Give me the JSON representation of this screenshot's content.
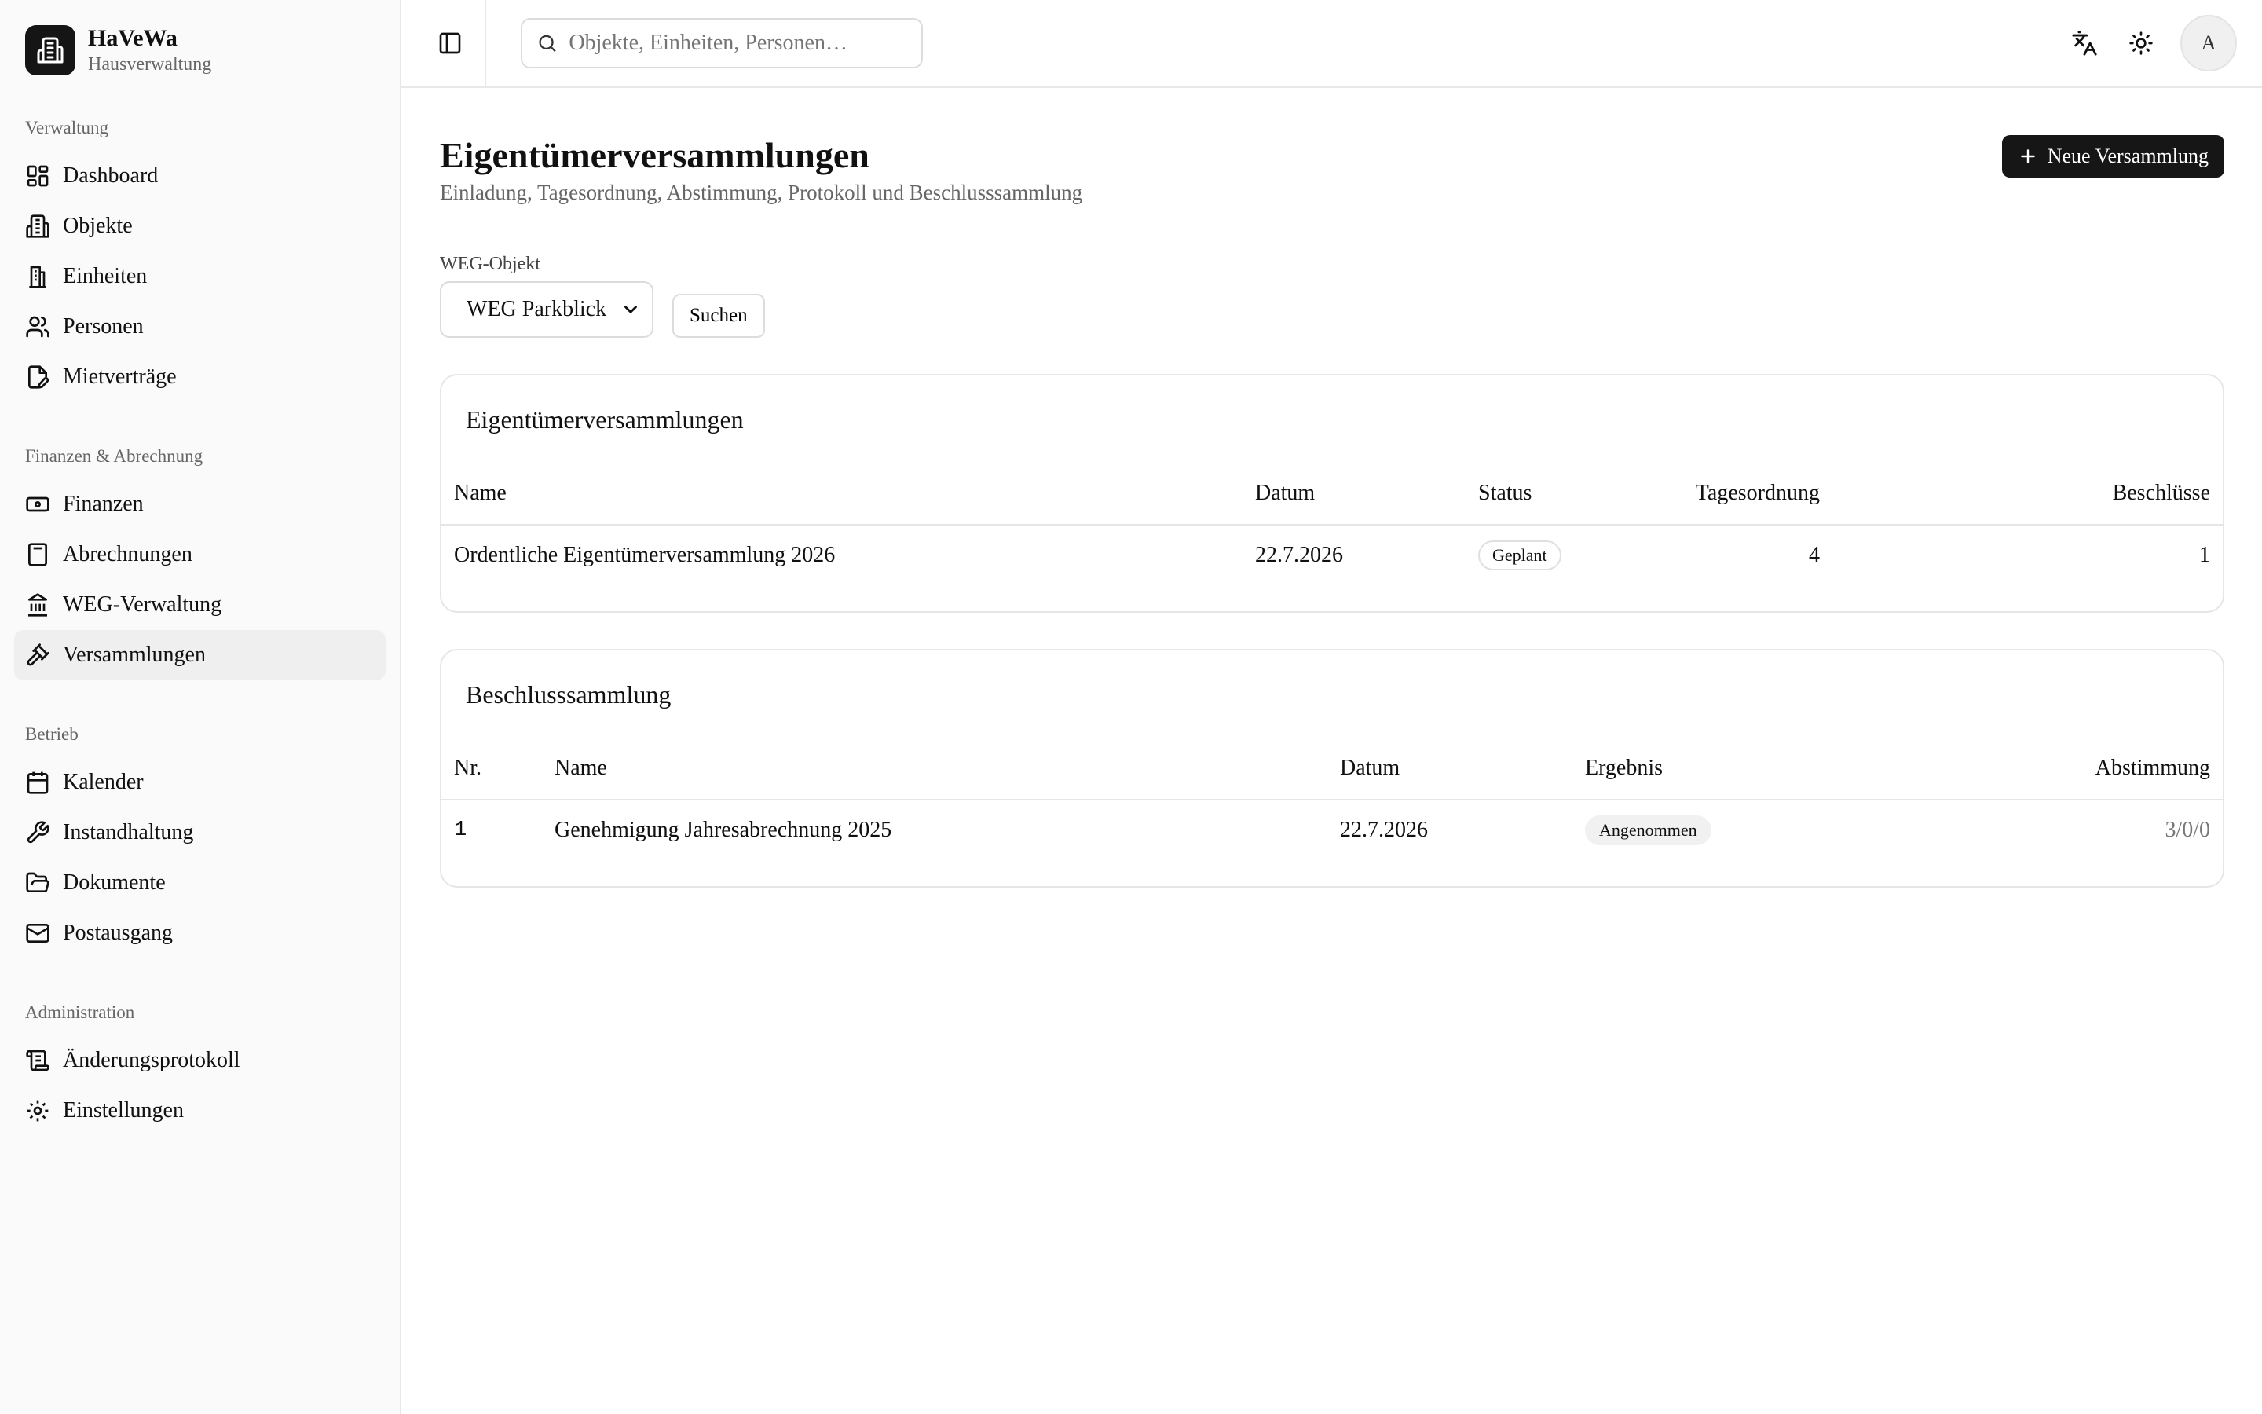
{
  "brand": {
    "title": "HaVeWa",
    "subtitle": "Hausverwaltung"
  },
  "sidebar": {
    "groups": [
      {
        "label": "Verwaltung",
        "items": [
          {
            "label": "Dashboard",
            "icon": "dashboard-icon"
          },
          {
            "label": "Objekte",
            "icon": "building-icon"
          },
          {
            "label": "Einheiten",
            "icon": "unit-icon"
          },
          {
            "label": "Personen",
            "icon": "users-icon"
          },
          {
            "label": "Mietverträge",
            "icon": "contract-icon"
          }
        ]
      },
      {
        "label": "Finanzen & Abrechnung",
        "items": [
          {
            "label": "Finanzen",
            "icon": "banknote-icon"
          },
          {
            "label": "Abrechnungen",
            "icon": "calculator-icon"
          },
          {
            "label": "WEG-Verwaltung",
            "icon": "landmark-icon"
          },
          {
            "label": "Versammlungen",
            "icon": "gavel-icon",
            "active": true
          }
        ]
      },
      {
        "label": "Betrieb",
        "items": [
          {
            "label": "Kalender",
            "icon": "calendar-icon"
          },
          {
            "label": "Instandhaltung",
            "icon": "wrench-icon"
          },
          {
            "label": "Dokumente",
            "icon": "folder-icon"
          },
          {
            "label": "Postausgang",
            "icon": "mail-icon"
          }
        ]
      },
      {
        "label": "Administration",
        "items": [
          {
            "label": "Änderungsprotokoll",
            "icon": "scroll-icon"
          },
          {
            "label": "Einstellungen",
            "icon": "gear-icon"
          }
        ]
      }
    ]
  },
  "topbar": {
    "search_placeholder": "Objekte, Einheiten, Personen…",
    "avatar_initial": "A"
  },
  "page": {
    "title": "Eigentümerversammlungen",
    "subtitle": "Einladung, Tagesordnung, Abstimmung, Protokoll und Beschlusssammlung",
    "new_button": "Neue Versammlung"
  },
  "filter": {
    "label": "WEG-Objekt",
    "selected": "WEG Parkblick",
    "search_button": "Suchen"
  },
  "meetings": {
    "title": "Eigentümerversammlungen",
    "columns": [
      "Name",
      "Datum",
      "Status",
      "Tagesordnung",
      "Beschlüsse"
    ],
    "rows": [
      {
        "name": "Ordentliche Eigentümerversammlung 2026",
        "date": "22.7.2026",
        "status": "Geplant",
        "agenda": "4",
        "resolutions": "1"
      }
    ]
  },
  "resolutions": {
    "title": "Beschlusssammlung",
    "columns": [
      "Nr.",
      "Name",
      "Datum",
      "Ergebnis",
      "Abstimmung"
    ],
    "rows": [
      {
        "nr": "1",
        "name": "Genehmigung Jahresabrechnung 2025",
        "date": "22.7.2026",
        "result": "Angenommen",
        "vote": "3/0/0"
      }
    ]
  }
}
